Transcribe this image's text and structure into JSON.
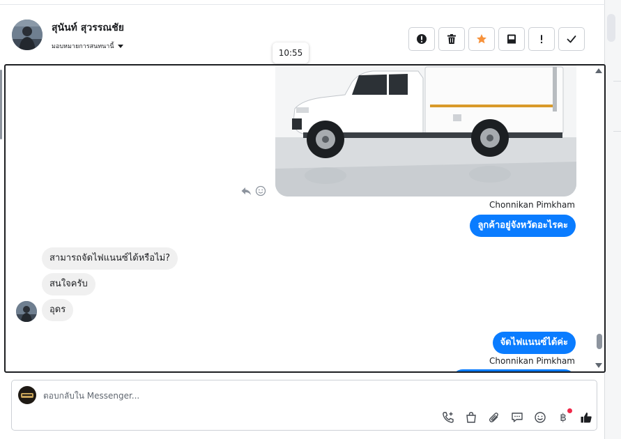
{
  "header": {
    "contact_name": "สุนันท์ สุวรรณชัย",
    "assign_label": "มอบหมายการสนทนานี้",
    "tooltip_time": "10:55",
    "actions": [
      {
        "name": "report-button",
        "icon": "alert-circle-icon"
      },
      {
        "name": "delete-button",
        "icon": "trash-icon"
      },
      {
        "name": "star-button",
        "icon": "star-icon",
        "color": "#f7923b"
      },
      {
        "name": "move-to-inbox-button",
        "icon": "inbox-icon"
      },
      {
        "name": "mark-important-button",
        "icon": "exclamation-icon"
      },
      {
        "name": "mark-done-button",
        "icon": "check-icon"
      }
    ]
  },
  "thread": {
    "attachment": {
      "icon": "truck-photo",
      "reply_icon": "reply-icon",
      "react_icon": "smiley-icon"
    },
    "messages": [
      {
        "direction": "out",
        "sender": "Chonnikan Pimkham",
        "text": "ลูกค้าอยู่จังหวัดอะไรคะ"
      },
      {
        "direction": "in",
        "text": "สามารถจัดไฟแนนซ์ได้หรือไม่?"
      },
      {
        "direction": "in",
        "text": "สนใจครับ"
      },
      {
        "direction": "in",
        "text": "อุดร"
      },
      {
        "direction": "out",
        "text": "จัดไฟแนนซ์ได้ค่ะ"
      },
      {
        "direction": "out",
        "sender": "Chonnikan Pimkham",
        "text": ""
      }
    ],
    "colors": {
      "outgoing": "#0a7cff",
      "incoming": "#f0f0f0"
    }
  },
  "composer": {
    "placeholder": "ตอบกลับใน Messenger...",
    "tools": [
      "call-add-icon",
      "shopping-bag-icon",
      "paperclip-icon",
      "chat-bubble-icon",
      "emoji-icon",
      "baht-icon",
      "thumbs-up-icon"
    ],
    "baht_symbol": "฿"
  }
}
